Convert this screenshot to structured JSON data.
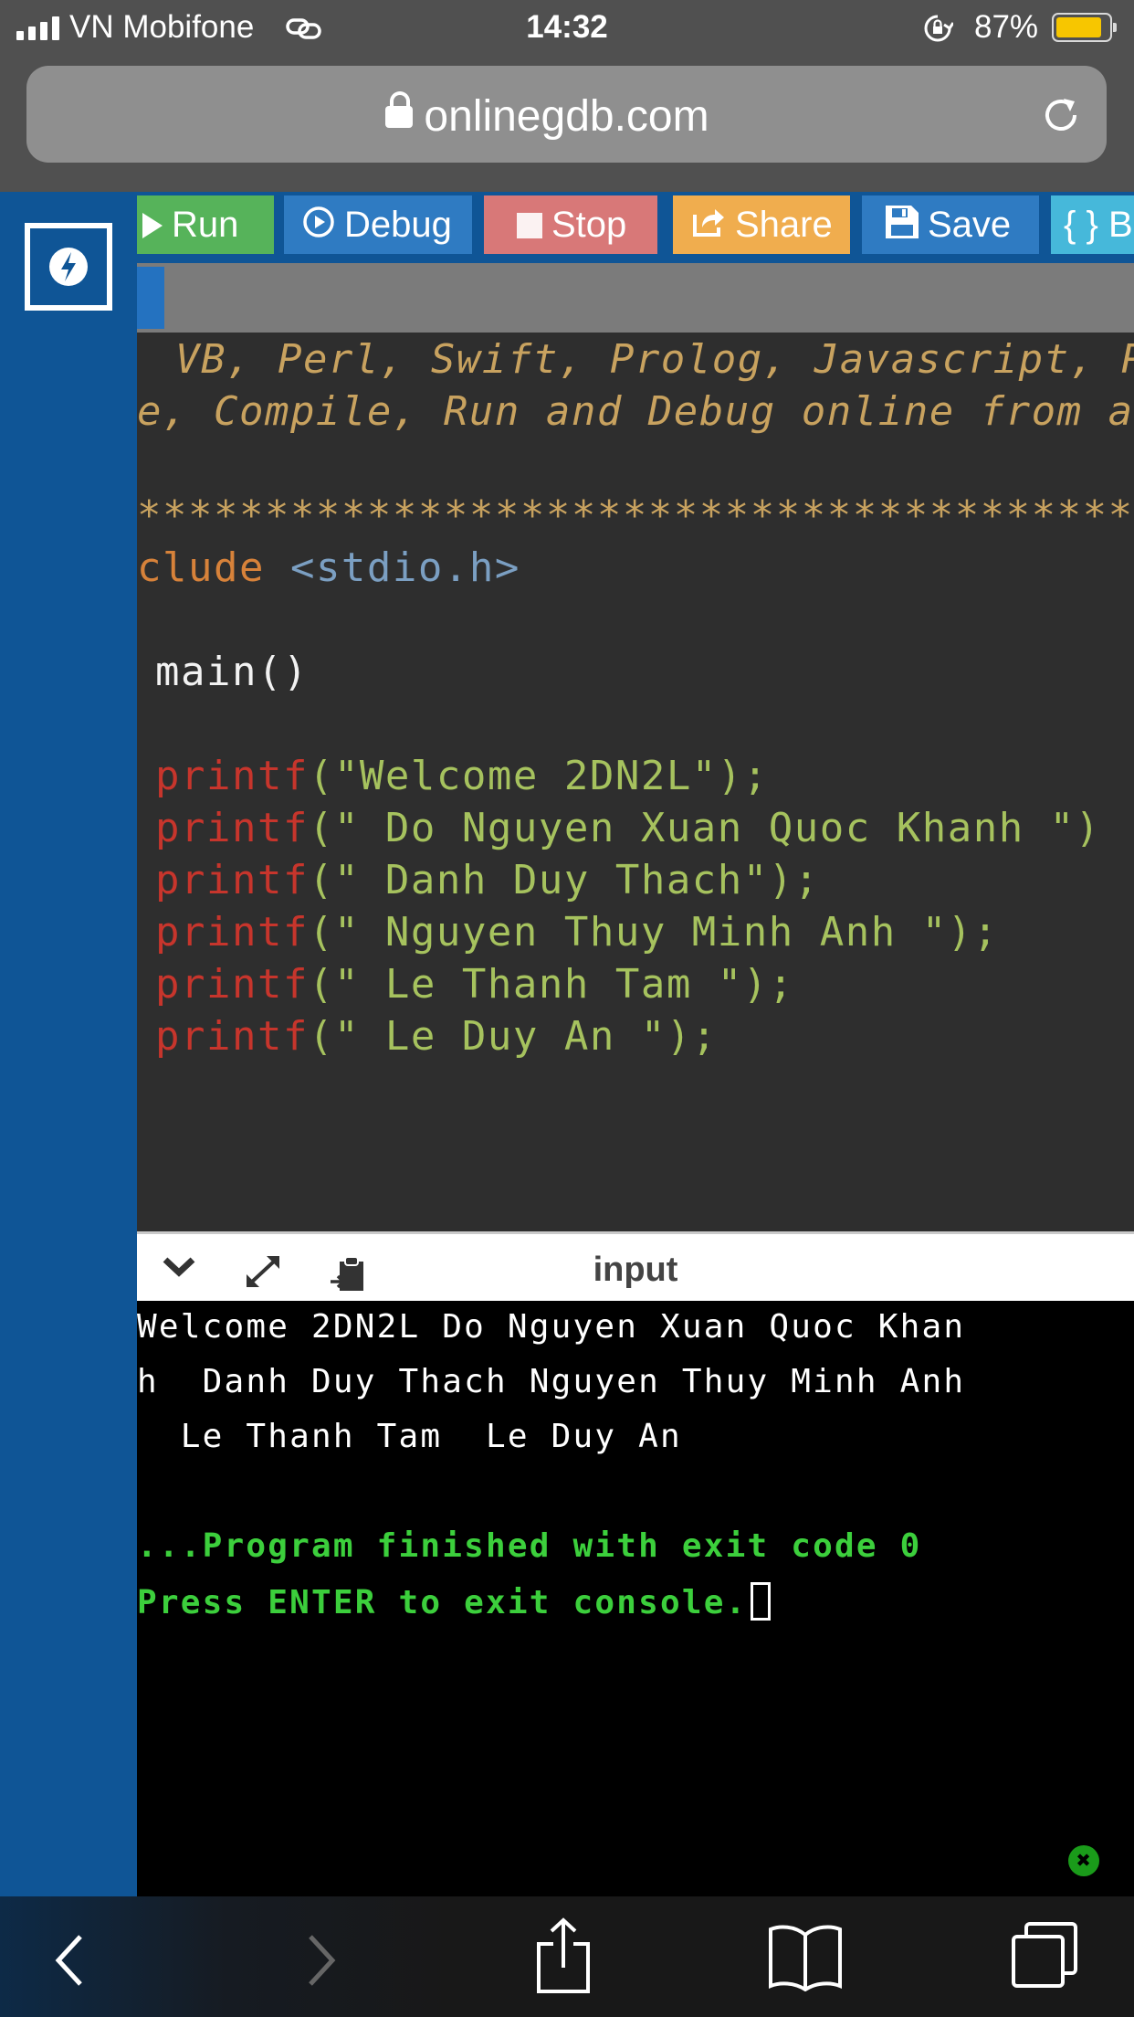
{
  "status_bar": {
    "carrier": "VN Mobifone",
    "time": "14:32",
    "battery_percent": "87%",
    "battery_level": 0.87,
    "battery_color": "#f7c600"
  },
  "browser": {
    "url": "onlinegdb.com",
    "lock_icon": "lock-icon",
    "reload_icon": "reload-icon"
  },
  "toolbar": {
    "run_label": "Run",
    "debug_label": "Debug",
    "stop_label": "Stop",
    "share_label": "Share",
    "save_label": "Save",
    "beautify_label": "{ } B",
    "colors": {
      "run": "#56b35a",
      "debug": "#2f7bc2",
      "stop": "#d87878",
      "share": "#f0ad4e",
      "save": "#2f7bc2",
      "beautify": "#46b8da"
    }
  },
  "editor": {
    "lines": [
      " VB, Perl, Swift, Prolog, Javascript, P",
      "e, Compile, Run and Debug online from a",
      "",
      "***************************************",
      "clude",
      "<stdio.h>",
      "main()",
      "printf",
      "(\"Welcome 2DN2L\");",
      "(\" Do Nguyen Xuan Quoc Khanh \")",
      "(\" Danh Duy Thach\");",
      "(\" Nguyen Thuy Minh Anh \");",
      "(\" Le Thanh Tam \");",
      "(\" Le Duy An \");"
    ]
  },
  "console": {
    "header_title": "input",
    "output_lines": [
      "Welcome 2DN2L Do Nguyen Xuan Quoc Khan",
      "h  Danh Duy Thach Nguyen Thuy Minh Anh",
      "  Le Thanh Tam  Le Duy An"
    ],
    "finished_line": "...Program finished with exit code 0",
    "press_enter_line": "Press ENTER to exit console."
  }
}
